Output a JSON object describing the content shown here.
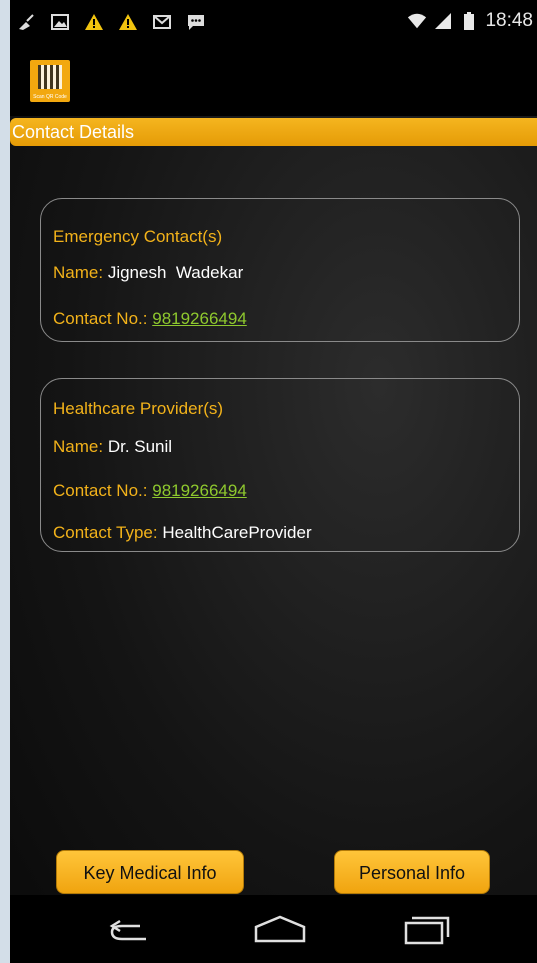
{
  "statusbar": {
    "time": "18:48",
    "left_icons": [
      "broom-icon",
      "image-icon",
      "warning-icon",
      "warning-icon",
      "gmail-icon",
      "message-icon"
    ],
    "right_icons": [
      "wifi-icon",
      "signal-icon",
      "battery-icon"
    ]
  },
  "app": {
    "logo_text": "Scan QR Code"
  },
  "page": {
    "section_title": "Contact Details"
  },
  "emergency": {
    "heading": "Emergency Contact(s)",
    "name_label": "Name:",
    "name_value": "Jignesh  Wadekar",
    "contact_label": "Contact No.:",
    "contact_value": "9819266494"
  },
  "healthcare": {
    "heading": "Healthcare Provider(s)",
    "name_label": "Name:",
    "name_value": "Dr. Sunil",
    "contact_label": "Contact No.:",
    "contact_value": "9819266494",
    "type_label": "Contact Type:",
    "type_value": "HealthCareProvider"
  },
  "buttons": {
    "key_medical": "Key Medical Info",
    "personal": "Personal Info"
  },
  "colors": {
    "accent": "#f2b21a",
    "link": "#8fc92e",
    "section_bar": "#f0a40f"
  }
}
